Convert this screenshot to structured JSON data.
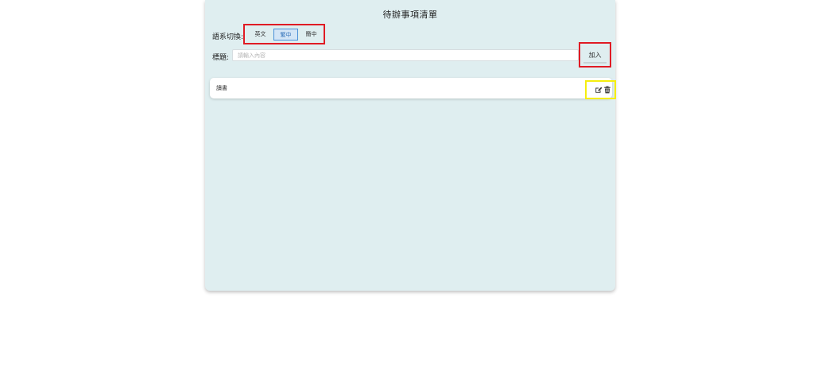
{
  "header": {
    "title": "待辦事項清單"
  },
  "language": {
    "label": "語系切換:",
    "options": [
      {
        "label": "英文",
        "active": false
      },
      {
        "label": "繁中",
        "active": true
      },
      {
        "label": "簡中",
        "active": false
      }
    ]
  },
  "form": {
    "label": "標題:",
    "placeholder": "請輸入內容",
    "value": "",
    "add_label": "加入"
  },
  "todos": [
    {
      "text": "讀書",
      "edit_icon": "edit-icon",
      "delete_icon": "trash-icon"
    }
  ],
  "colors": {
    "card_bg": "#dfeef0",
    "active_lang": "#4a8fd8",
    "highlight_red": "#e01b24",
    "highlight_yellow": "#f5ee0e"
  }
}
